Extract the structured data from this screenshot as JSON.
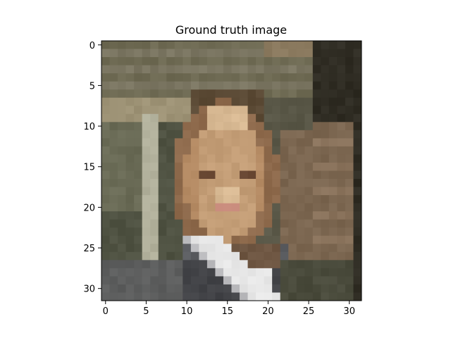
{
  "chart_data": {
    "type": "heatmap",
    "title": "Ground truth image",
    "xlabel": "",
    "ylabel": "",
    "xlim": [
      -0.5,
      31.5
    ],
    "ylim": [
      31.5,
      -0.5
    ],
    "grid": false,
    "legend": "none",
    "xticks": [
      0,
      5,
      10,
      15,
      20,
      25,
      30
    ],
    "yticks": [
      0,
      5,
      10,
      15,
      20,
      25,
      30
    ],
    "image_rows": 32,
    "image_cols": 32,
    "palette": {
      "bg_wall": "#6e6a53",
      "bg_wall_dark": "#5a5848",
      "bg_wall_light": "#7b7662",
      "ceiling_light": "#8b7a5f",
      "beam": "#9e9376",
      "left_panel": "#6a6b56",
      "left_panel_dark": "#4f5242",
      "pole": "#b1b09b",
      "right_edge": "#2f2c23",
      "right_brown": "#7b6650",
      "right_brown_light": "#8a735c",
      "hair": "#5b4a35",
      "skin": "#c39d76",
      "skin_light": "#d8b993",
      "skin_mid": "#b48a63",
      "skin_dark": "#8e6a4c",
      "eye": "#6b4a35",
      "lips": "#c98c7d",
      "neck": "#6e5642",
      "shirt_dark": "#434448",
      "shirt_mid": "#5a5c60",
      "collar": "#e6e6e6",
      "collar_shadow": "#b9b9bc",
      "jacket_olive": "#4a4b3c",
      "floor": "#5d5e5e"
    }
  }
}
